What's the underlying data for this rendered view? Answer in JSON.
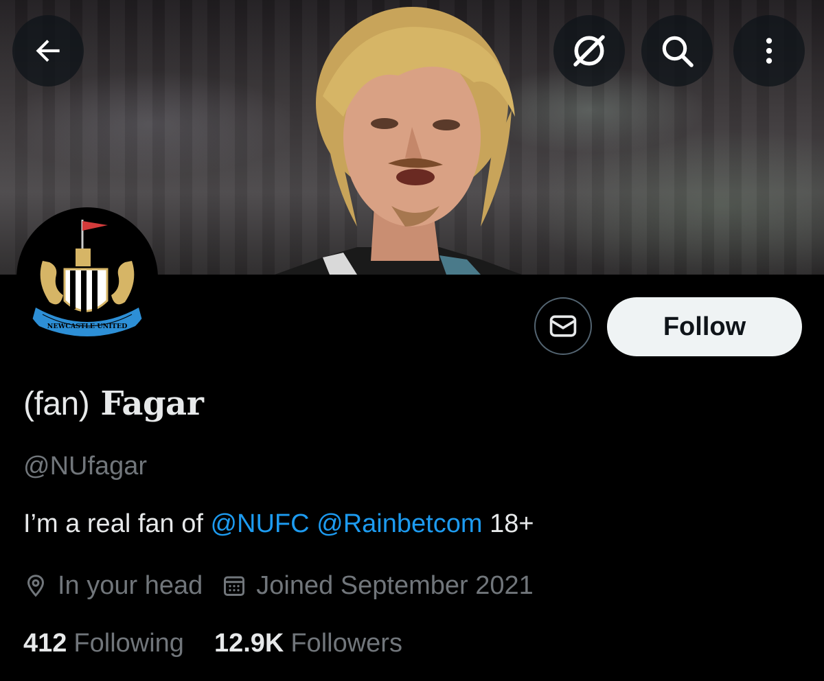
{
  "header": {
    "back_icon": "arrow-left-icon",
    "grok_icon": "grok-icon",
    "search_icon": "search-icon",
    "more_icon": "more-vertical-icon"
  },
  "avatar": {
    "crest_text": "NEWCASTLE UNITED"
  },
  "actions": {
    "message_icon": "envelope-icon",
    "follow_label": "Follow"
  },
  "profile": {
    "name_paren": "(fan)",
    "name_main": "Fagar",
    "handle": "@NUfagar",
    "bio_prefix": "I’m a real fan of ",
    "bio_mention_1": "@NUFC",
    "bio_mention_2": "@Rainbetcom",
    "bio_suffix": "18+",
    "location": "In your head",
    "joined": "Joined September 2021"
  },
  "stats": {
    "following_count": "412",
    "following_label": "Following",
    "followers_count": "12.9K",
    "followers_label": "Followers"
  },
  "colors": {
    "accent": "#1d9bf0",
    "muted": "#71767b",
    "background": "#000000"
  }
}
